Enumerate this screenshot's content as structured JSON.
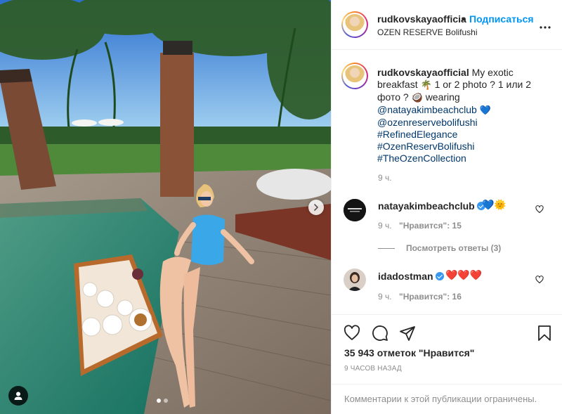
{
  "header": {
    "username": "rudkovskayaofficia",
    "separator": "•",
    "follow_label": "Подписаться",
    "location": "OZEN RESERVE Bolifushi"
  },
  "caption": {
    "username": "rudkovskayaofficial",
    "text_1": "My exotic breakfast",
    "emoji_1": "🌴",
    "text_2": "1 or 2 photo ? 1 или 2 фото ?",
    "emoji_2": "🥥",
    "text_3": "wearing",
    "mention_1": "@natayakimbeachclub",
    "emoji_3": "💙",
    "mention_2": "@ozenreservebolifushi",
    "hashtag_1": "#RefinedElegance",
    "hashtag_2": "#OzenReservBolifushi",
    "hashtag_3": "#TheOzenCollection",
    "time": "9 ч."
  },
  "comments": [
    {
      "username": "natayakimbeachclub",
      "emojis": "💙🌞",
      "time": "9 ч.",
      "likes_label": "\"Нравится\": 15",
      "view_replies": "Посмотреть ответы (3)"
    },
    {
      "username": "idadostman",
      "emojis": "❤️❤️❤️",
      "time": "9 ч.",
      "likes_label": "\"Нравится\": 16"
    }
  ],
  "actions": {
    "like_icon": "heart-icon",
    "comment_icon": "comment-icon",
    "share_icon": "share-icon",
    "save_icon": "bookmark-icon"
  },
  "likes_text": "35 943 отметок \"Нравится\"",
  "posted_ago": "9 ЧАСОВ НАЗАД",
  "comments_limited": "Комментарии к этой публикации ограничены.",
  "carousel": {
    "total": 2,
    "active": 1
  },
  "colors": {
    "accent": "#0095f6",
    "verified": "#3897f0",
    "heart": "#ed4956"
  }
}
